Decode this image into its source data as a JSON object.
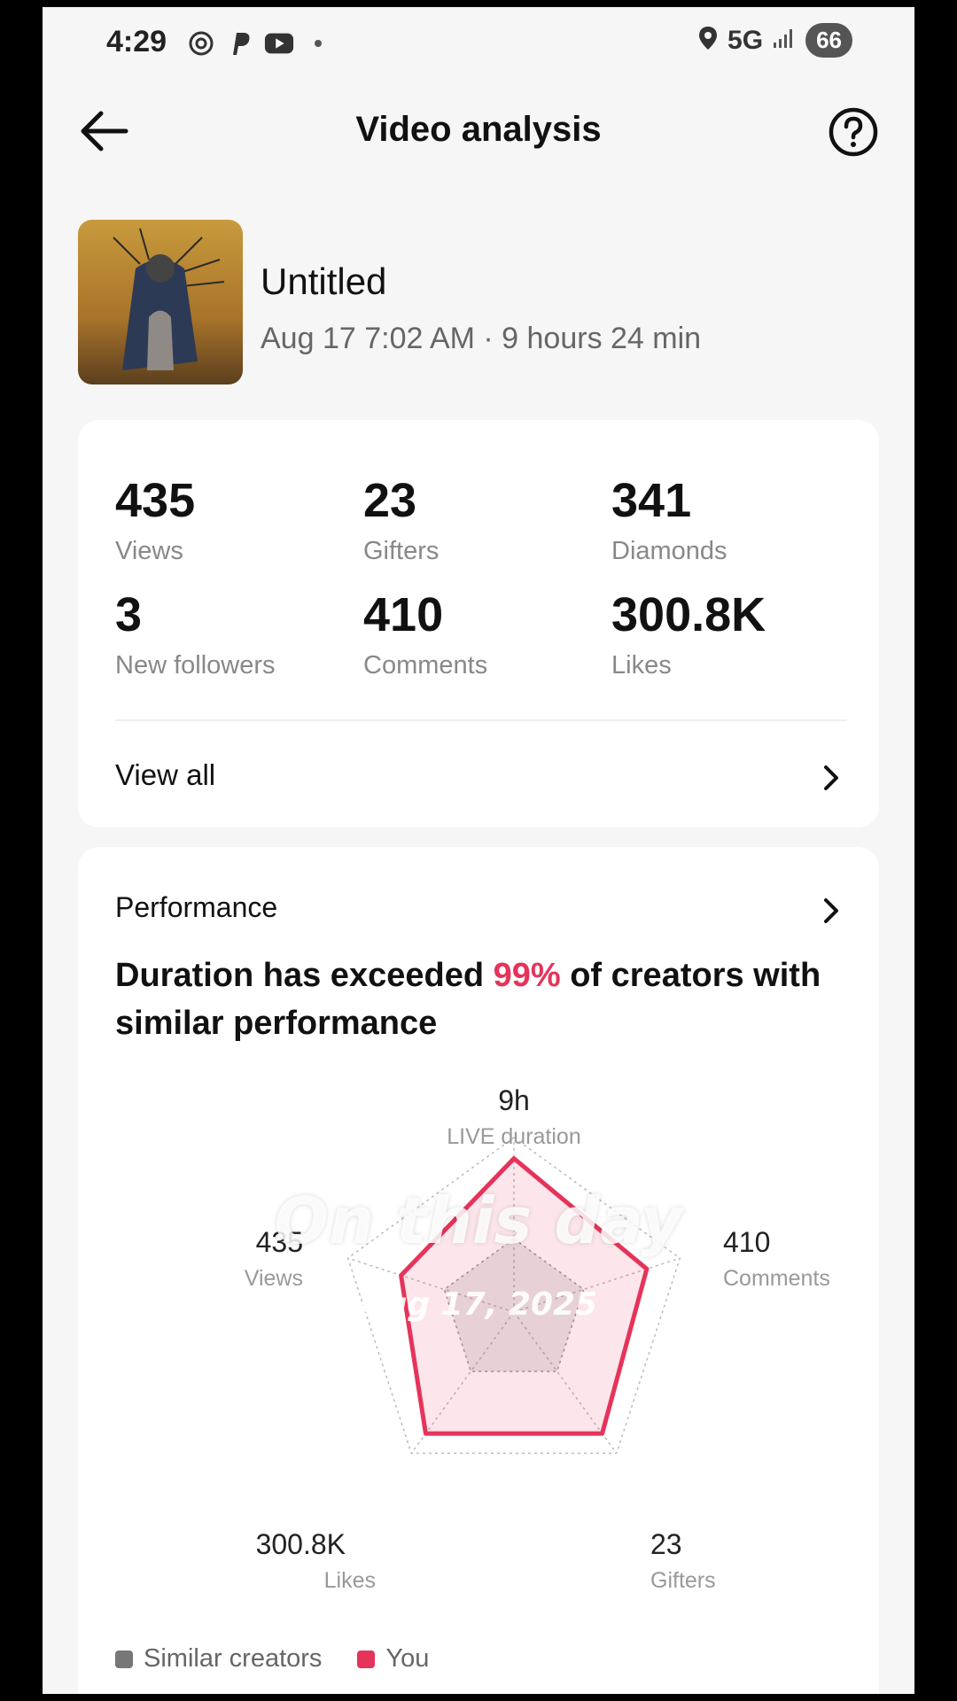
{
  "status_bar": {
    "time": "4:29",
    "network": "5G",
    "battery": "66"
  },
  "header": {
    "title": "Video analysis"
  },
  "video": {
    "title": "Untitled",
    "meta": "Aug 17 7:02 AM · 9 hours 24 min"
  },
  "stats": [
    {
      "value": "435",
      "label": "Views"
    },
    {
      "value": "23",
      "label": "Gifters"
    },
    {
      "value": "341",
      "label": "Diamonds"
    },
    {
      "value": "3",
      "label": "New followers"
    },
    {
      "value": "410",
      "label": "Comments"
    },
    {
      "value": "300.8K",
      "label": "Likes"
    }
  ],
  "view_all": "View all",
  "performance": {
    "label": "Performance",
    "headline_pre": "Duration has exceeded ",
    "headline_pct": "99%",
    "headline_post": " of creators with similar performance"
  },
  "overlay": {
    "line1": "On this day",
    "line2": "Aug 17, 2025"
  },
  "legend": {
    "similar": "Similar creators",
    "you": "You"
  },
  "colors": {
    "accent": "#e6335a",
    "similar": "#777777"
  },
  "chart_data": {
    "type": "radar",
    "axes": [
      {
        "name": "LIVE duration",
        "value_label": "9h"
      },
      {
        "name": "Comments",
        "value_label": "410"
      },
      {
        "name": "Gifters",
        "value_label": "23"
      },
      {
        "name": "Likes",
        "value_label": "300.8K"
      },
      {
        "name": "Views",
        "value_label": "435"
      }
    ],
    "series": [
      {
        "name": "Similar creators",
        "values": [
          0.42,
          0.42,
          0.42,
          0.42,
          0.42
        ]
      },
      {
        "name": "You",
        "values": [
          0.88,
          0.8,
          0.86,
          0.86,
          0.68
        ]
      }
    ],
    "max": 1
  }
}
